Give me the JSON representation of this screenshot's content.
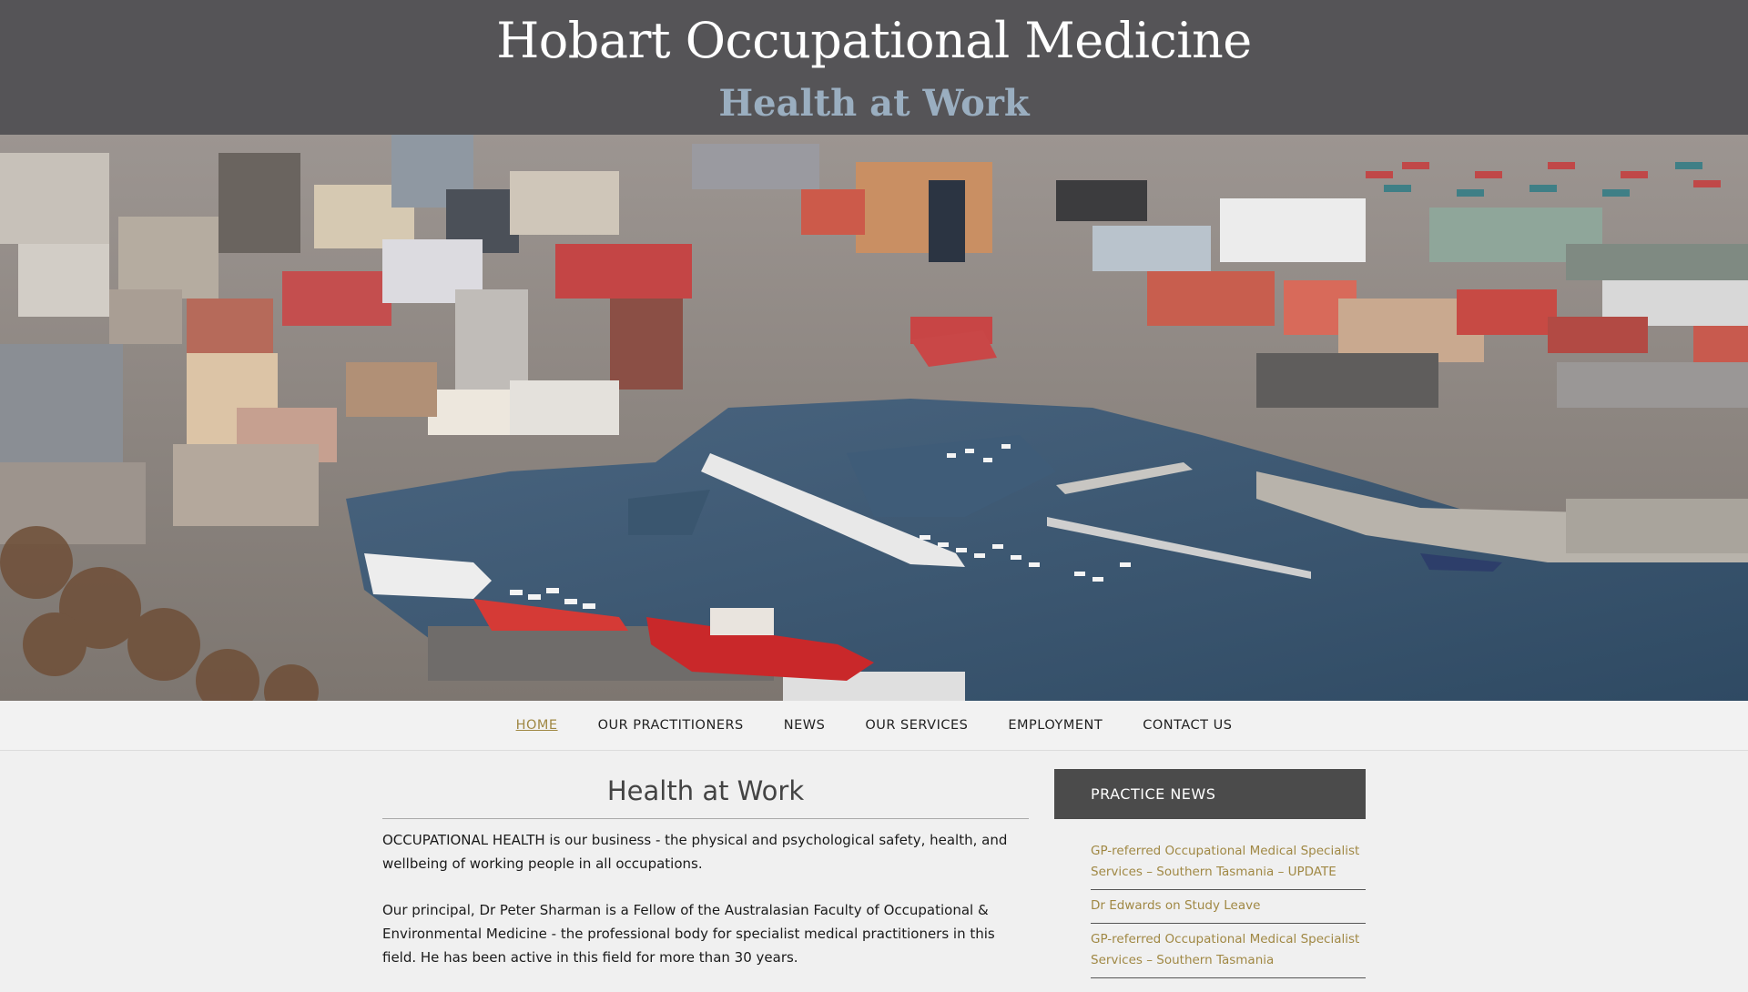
{
  "header": {
    "site_title": "Hobart Occupational Medicine",
    "tagline": "Health at Work"
  },
  "hero": {
    "image_description": "aerial photo of Hobart waterfront and harbour"
  },
  "nav": {
    "items": [
      {
        "label": "HOME",
        "active": true
      },
      {
        "label": "OUR PRACTITIONERS",
        "active": false
      },
      {
        "label": "NEWS",
        "active": false
      },
      {
        "label": "OUR SERVICES",
        "active": false
      },
      {
        "label": "EMPLOYMENT",
        "active": false
      },
      {
        "label": "CONTACT US",
        "active": false
      }
    ]
  },
  "main": {
    "title": "Health at Work",
    "paragraphs": [
      "OCCUPATIONAL HEALTH is our business - the physical and psychological safety, health, and wellbeing of working people in all occupations.",
      "Our principal, Dr Peter Sharman is a Fellow of the Australasian Faculty of Occupational & Environmental Medicine - the professional body for specialist medical practitioners in this field. He has been active in this field for more than 30 years."
    ]
  },
  "sidebar": {
    "widget_title": "PRACTICE NEWS",
    "news": [
      "GP-referred Occupational Medical Specialist Services – Southern Tasmania – UPDATE",
      "Dr Edwards on Study Leave",
      "GP-referred Occupational Medical Specialist Services – Southern Tasmania"
    ]
  },
  "colors": {
    "header_bg": "#555457",
    "tagline": "#9aaec0",
    "accent_link": "#a08844",
    "widget_title_bg": "#4b4b4b"
  }
}
